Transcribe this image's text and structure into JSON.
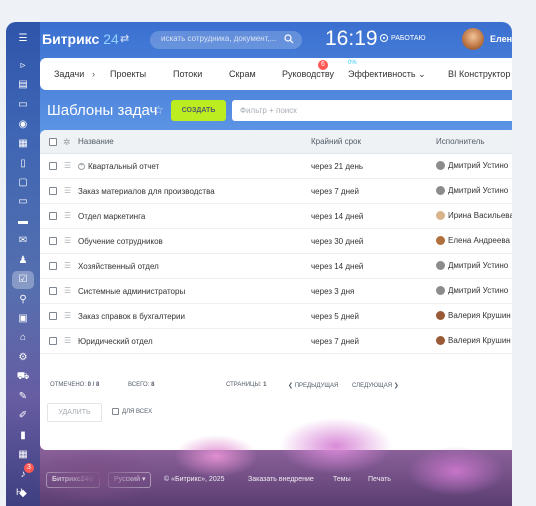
{
  "header": {
    "logo_name": "Битрикс",
    "logo_number": "24",
    "logo_arrows": "⇄",
    "search_placeholder": "искать сотрудника, документ,...",
    "clock": "16:19",
    "status": "РАБОТАЮ",
    "user_name": "Елена"
  },
  "rail": {
    "counter": "3",
    "bottom_label": "Н"
  },
  "topnav": {
    "items": [
      "Задачи",
      "Проекты",
      "Потоки",
      "Скрам",
      "Руководству",
      "Эффективность",
      "BI Конструктор"
    ],
    "badge": "6",
    "efficiency_percent": "0%"
  },
  "page": {
    "title": "Шаблоны задач",
    "create_button": "СОЗДАТЬ",
    "filter_placeholder": "Фильтр + поиск"
  },
  "grid": {
    "columns": {
      "name": "Название",
      "deadline": "Крайний срок",
      "responsible": "Исполнитель"
    },
    "rows": [
      {
        "name": "Квартальный отчет",
        "deadline": "через 21 день",
        "responsible": "Дмитрий Устино",
        "has_subtasks": true
      },
      {
        "name": "Заказ материалов для производства",
        "deadline": "через 7 дней",
        "responsible": "Дмитрий Устино",
        "has_subtasks": false
      },
      {
        "name": "Отдел маркетинга",
        "deadline": "через 14 дней",
        "responsible": "Ирина Васильева",
        "has_subtasks": false
      },
      {
        "name": "Обучение сотрудников",
        "deadline": "через 30 дней",
        "responsible": "Елена Андреева",
        "has_subtasks": false
      },
      {
        "name": "Хозяйственный отдел",
        "deadline": "через 14 дней",
        "responsible": "Дмитрий Устино",
        "has_subtasks": false
      },
      {
        "name": "Системные администраторы",
        "deadline": "через 3 дня",
        "responsible": "Дмитрий Устино",
        "has_subtasks": false
      },
      {
        "name": "Заказ справок в бухгалтерии",
        "deadline": "через 5 дней",
        "responsible": "Валерия Крушин",
        "has_subtasks": false
      },
      {
        "name": "Юридический отдел",
        "deadline": "через 7 дней",
        "responsible": "Валерия Крушин",
        "has_subtasks": false
      }
    ],
    "footer": {
      "selected_label": "ОТМЕЧЕНО:",
      "selected_value": "0 / 8",
      "total_label": "ВСЕГО:",
      "total_value": "8",
      "pages_label": "СТРАНИЦЫ:",
      "pages_value": "1",
      "prev": "❮ ПРЕДЫДУЩАЯ",
      "next": "СЛЕДУЮЩАЯ ❯"
    },
    "delete_button": "УДАЛИТЬ",
    "for_all": "ДЛЯ ВСЕХ"
  },
  "footer": {
    "brand": "Битрикс24®",
    "language": "Русский",
    "copyright": "© «Битрикс», 2025",
    "order": "Заказать внедрение",
    "themes": "Темы",
    "print": "Печать"
  },
  "colors": {
    "accent_green": "#bbed21",
    "counter_red": "#ff5752",
    "logo_blue": "#8fd3ff"
  }
}
